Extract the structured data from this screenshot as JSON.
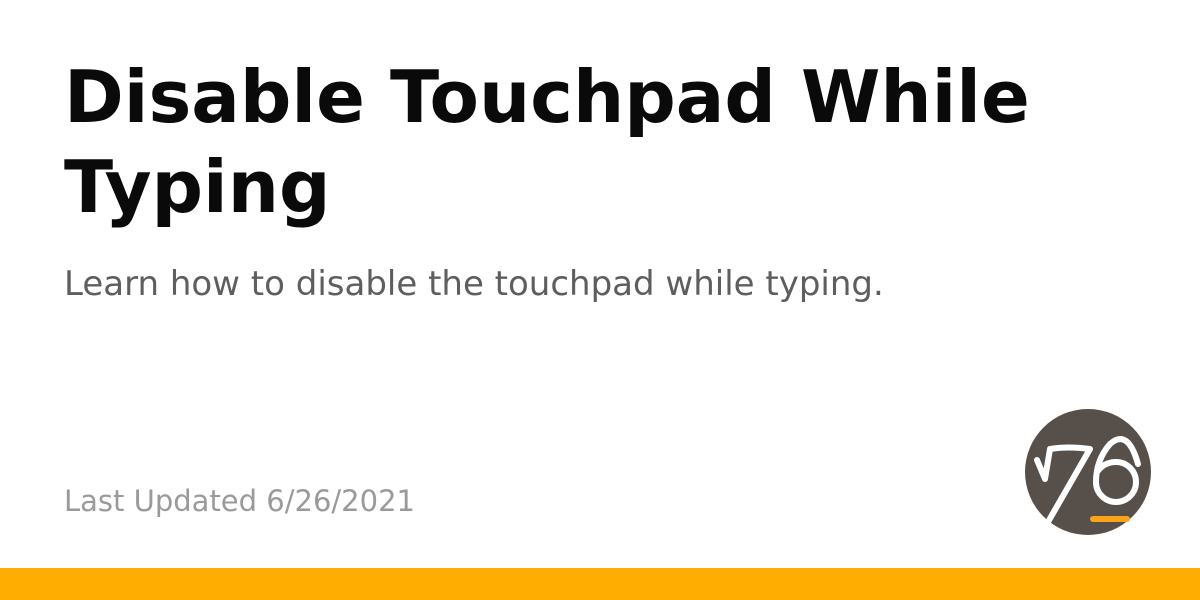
{
  "article": {
    "title": "Disable Touchpad While Typing",
    "description": "Learn how to disable the touchpad while typing.",
    "last_updated": "Last Updated 6/26/2021"
  },
  "logo": {
    "icon": "system76-logo-icon",
    "background_color": "#574f4a",
    "stroke_color": "#ffffff",
    "accent_color": "#faa41a"
  },
  "footer": {
    "bar_color": "#ffad00"
  }
}
